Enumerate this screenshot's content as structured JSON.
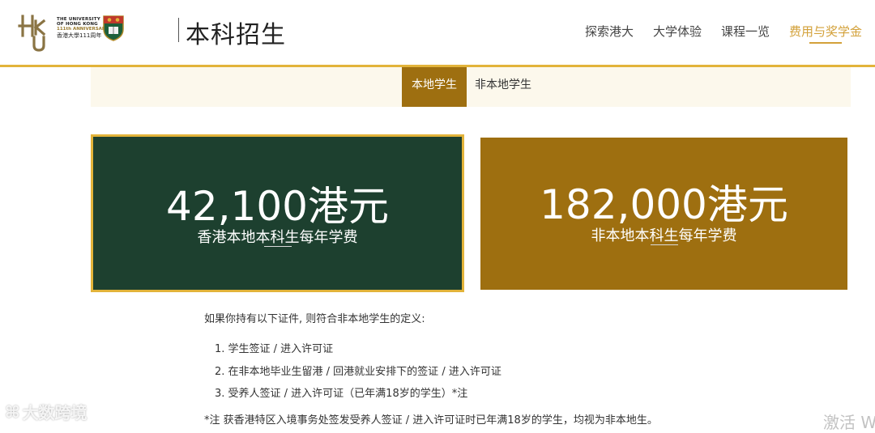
{
  "header": {
    "logo": {
      "monogram": "HKU",
      "line1": "THE UNIVERSITY",
      "line2": "OF HONG KONG",
      "line3": "香港大學",
      "anniversary_en": "111th ANNIVERSARY",
      "anniversary_zh": "香港大學111周年"
    },
    "title": "本科招生",
    "nav": [
      {
        "label": "探索港大"
      },
      {
        "label": "大学体验"
      },
      {
        "label": "课程一览"
      },
      {
        "label": "费用与奖学金",
        "active": true
      }
    ]
  },
  "tabs": [
    {
      "label": "本地学生",
      "selected": true
    },
    {
      "label": "非本地学生",
      "selected": false
    }
  ],
  "fees": [
    {
      "amount": "42,100港元",
      "label": "香港本地本科生每年学费",
      "color": "#1d402f"
    },
    {
      "amount": "182,000港元",
      "label": "非本地本科生每年学费",
      "color": "#9e6f10"
    }
  ],
  "notes": {
    "intro": "如果你持有以下证件, 则符合非本地学生的定义:",
    "items": [
      "1. 学生签证 / 进入许可证",
      "2. 在非本地毕业生留港 / 回港就业安排下的签证 / 进入许可证",
      "3. 受养人签证 / 进入许可证（已年满18岁的学生）*注"
    ],
    "footnote": "*注 获香港特区入境事务处签发受养人签证 / 进入许可证时已年满18岁的学生，均视为非本地生。"
  },
  "watermarks": {
    "left": "大数跨境",
    "right": "激活 W"
  },
  "colors": {
    "accent_gold": "#e2b33a",
    "nav_active": "#d3a13a",
    "tab_active": "#9e6f10",
    "card_green": "#1d402f",
    "card_gold": "#9e6f10"
  }
}
